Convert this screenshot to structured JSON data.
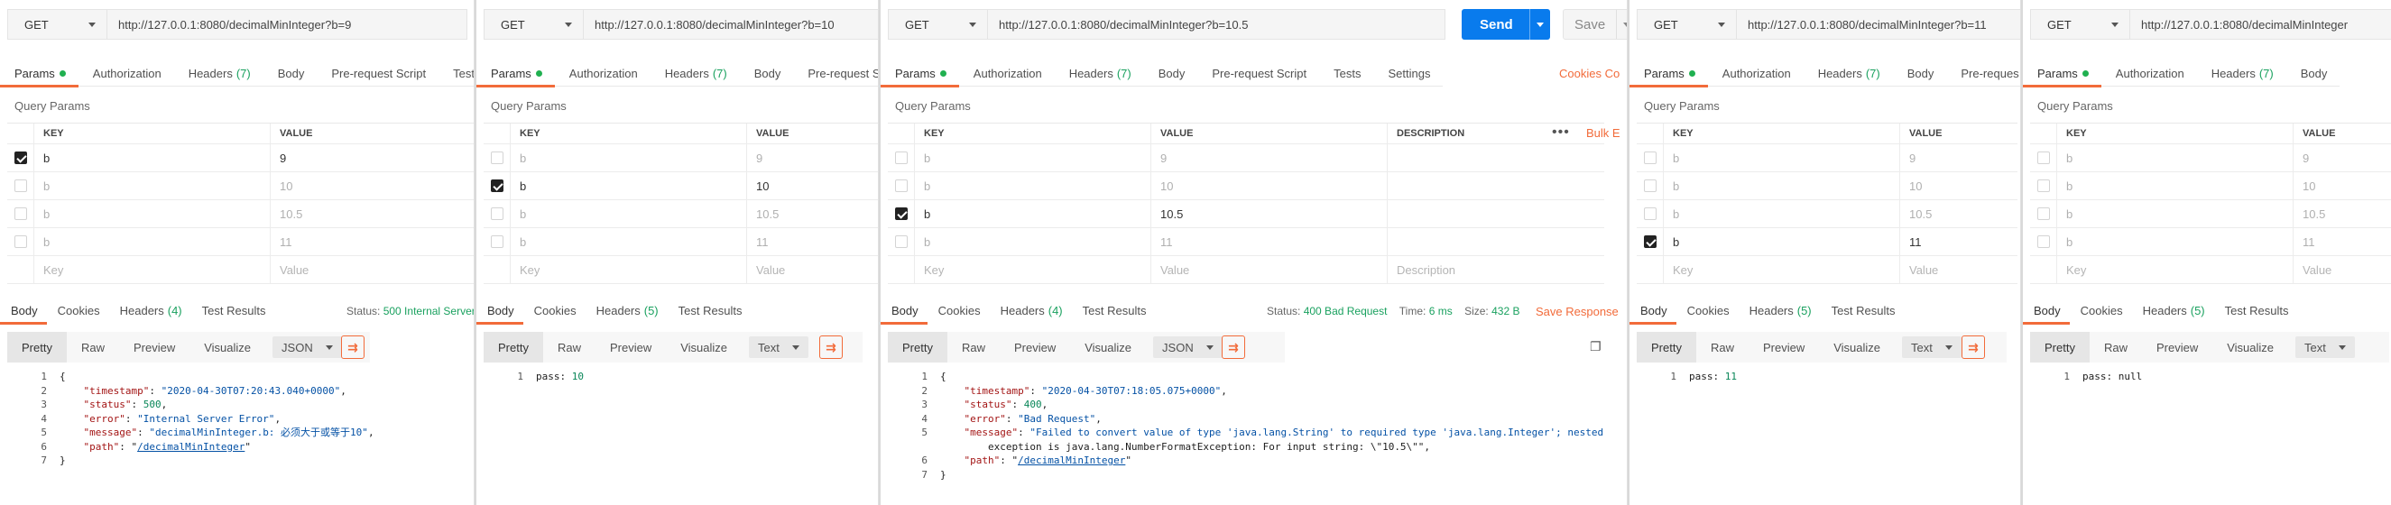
{
  "tabs": {
    "params": "Params",
    "authorization": "Authorization",
    "headers": "Headers",
    "headers_count": "(7)",
    "body": "Body",
    "prerequest_full": "Pre-request Script",
    "prerequest_cut2": "Pre-request S",
    "prerequest_cut4": "Pre-reques",
    "tests": "Tests",
    "tests_cut": "Test",
    "settings": "Settings",
    "cookies": "Cookies",
    "cookies_cut": "Co"
  },
  "query_params_title": "Query Params",
  "table_head": {
    "key": "KEY",
    "value": "VALUE",
    "description": "DESCRIPTION",
    "bulk_edit": "Bulk Ed",
    "bulk_edit_cut": "Bulk E"
  },
  "param_rows": [
    {
      "key": "b",
      "value": "9"
    },
    {
      "key": "b",
      "value": "10"
    },
    {
      "key": "b",
      "value": "10.5"
    },
    {
      "key": "b",
      "value": "11"
    }
  ],
  "placeholders": {
    "key": "Key",
    "value": "Value",
    "description": "Description"
  },
  "resp_tabs": {
    "body": "Body",
    "cookies": "Cookies",
    "headers": "Headers",
    "test_results": "Test Results"
  },
  "format": {
    "pretty": "Pretty",
    "raw": "Raw",
    "preview": "Preview",
    "visualize": "Visualize",
    "json": "JSON",
    "text": "Text"
  },
  "send": {
    "label": "Send",
    "save": "Save"
  },
  "method": "GET",
  "colors": {
    "accent": "#f26b3a",
    "send_blue": "#097bed",
    "ok_green": "#1aa15f"
  },
  "icons": [
    "chevron-down-icon",
    "checkbox-checked-icon",
    "wrap-lines-icon",
    "copy-icon",
    "more-icon"
  ],
  "panels": [
    {
      "url": "http://127.0.0.1:8080/decimalMinInteger?b=9",
      "checked_row": 0,
      "headers_resp_count": "(4)",
      "status_label": "Status:",
      "status_value": "500 Internal Server",
      "format": "JSON",
      "code": [
        "{",
        "    \"timestamp\": \"2020-04-30T07:20:43.040+0000\",",
        "    \"status\": 500,",
        "    \"error\": \"Internal Server Error\",",
        "    \"message\": \"decimalMinInteger.b: 必须大于或等于10\",",
        "    \"path\": \"/decimalMinInteger\"",
        "}"
      ]
    },
    {
      "url": "http://127.0.0.1:8080/decimalMinInteger?b=10",
      "checked_row": 1,
      "headers_resp_count": "(5)",
      "format": "Text",
      "code": [
        "pass: 10"
      ]
    },
    {
      "url": "http://127.0.0.1:8080/decimalMinInteger?b=10.5",
      "checked_row": 2,
      "headers_resp_count": "(4)",
      "status_label": "Status:",
      "status_value": "400 Bad Request",
      "time_label": "Time:",
      "time_value": "6 ms",
      "size_label": "Size:",
      "size_value": "432 B",
      "save_response": "Save Response",
      "format": "JSON",
      "code": [
        "{",
        "    \"timestamp\": \"2020-04-30T07:18:05.075+0000\",",
        "    \"status\": 400,",
        "    \"error\": \"Bad Request\",",
        "    \"message\": \"Failed to convert value of type 'java.lang.String' to required type 'java.lang.Integer'; nested",
        "        exception is java.lang.NumberFormatException: For input string: \\\"10.5\\\"\",",
        "    \"path\": \"/decimalMinInteger\"",
        "}"
      ],
      "line_numbers": [
        "1",
        "2",
        "3",
        "4",
        "5",
        "",
        "6",
        "7"
      ]
    },
    {
      "url": "http://127.0.0.1:8080/decimalMinInteger?b=11",
      "checked_row": 3,
      "headers_resp_count": "(5)",
      "format": "Text",
      "code": [
        "pass: 11"
      ]
    },
    {
      "url": "http://127.0.0.1:8080/decimalMinInteger",
      "checked_row": -1,
      "headers_resp_count": "(5)",
      "format": "Text",
      "code": [
        "pass: null"
      ]
    }
  ]
}
